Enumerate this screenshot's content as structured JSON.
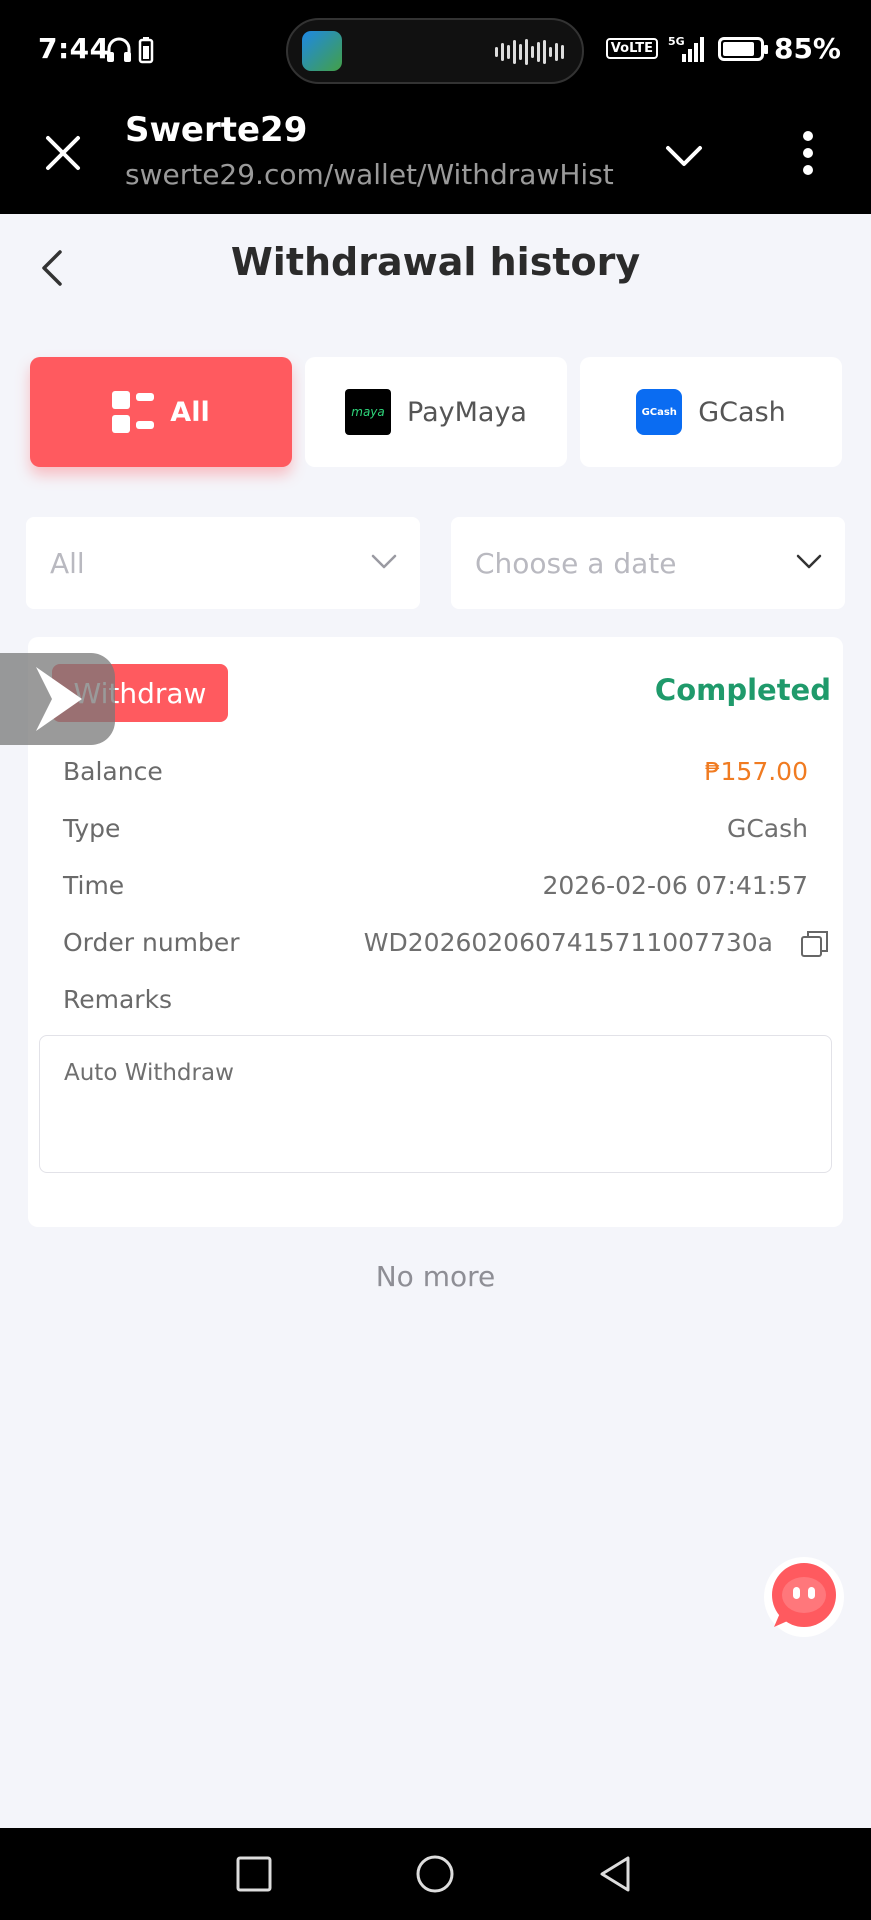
{
  "status_bar": {
    "time": "7:44",
    "volte": "VoLTE",
    "network": "5G",
    "battery": "85%",
    "battery_level": 0.85
  },
  "browser": {
    "title": "Swerte29",
    "url": "swerte29.com/wallet/WithdrawHist"
  },
  "page": {
    "title": "Withdrawal history"
  },
  "tabs": [
    {
      "label": "All",
      "icon": "grid-icon",
      "active": true
    },
    {
      "label": "PayMaya",
      "icon": "maya-logo-icon",
      "logo_text": "maya",
      "active": false
    },
    {
      "label": "GCash",
      "icon": "gcash-logo-icon",
      "logo_text": "GCash",
      "active": false
    }
  ],
  "filters": {
    "type": "All",
    "date_placeholder": "Choose a date"
  },
  "record": {
    "badge": "Withdraw",
    "status": "Completed",
    "rows": [
      {
        "key": "Balance",
        "value": "₱157.00"
      },
      {
        "key": "Type",
        "value": "GCash"
      },
      {
        "key": "Time",
        "value": "2026-02-06 07:41:57"
      },
      {
        "key": "Order number",
        "value": "WD2026020607415711007730a"
      },
      {
        "key": "Remarks",
        "value": ""
      }
    ],
    "remarks": "Auto Withdraw"
  },
  "footer_text": "No more",
  "colors": {
    "accent": "#ff5a5f",
    "status_completed": "#1f9a6b",
    "balance": "#f07b21",
    "page_bg": "#f4f5fa"
  }
}
